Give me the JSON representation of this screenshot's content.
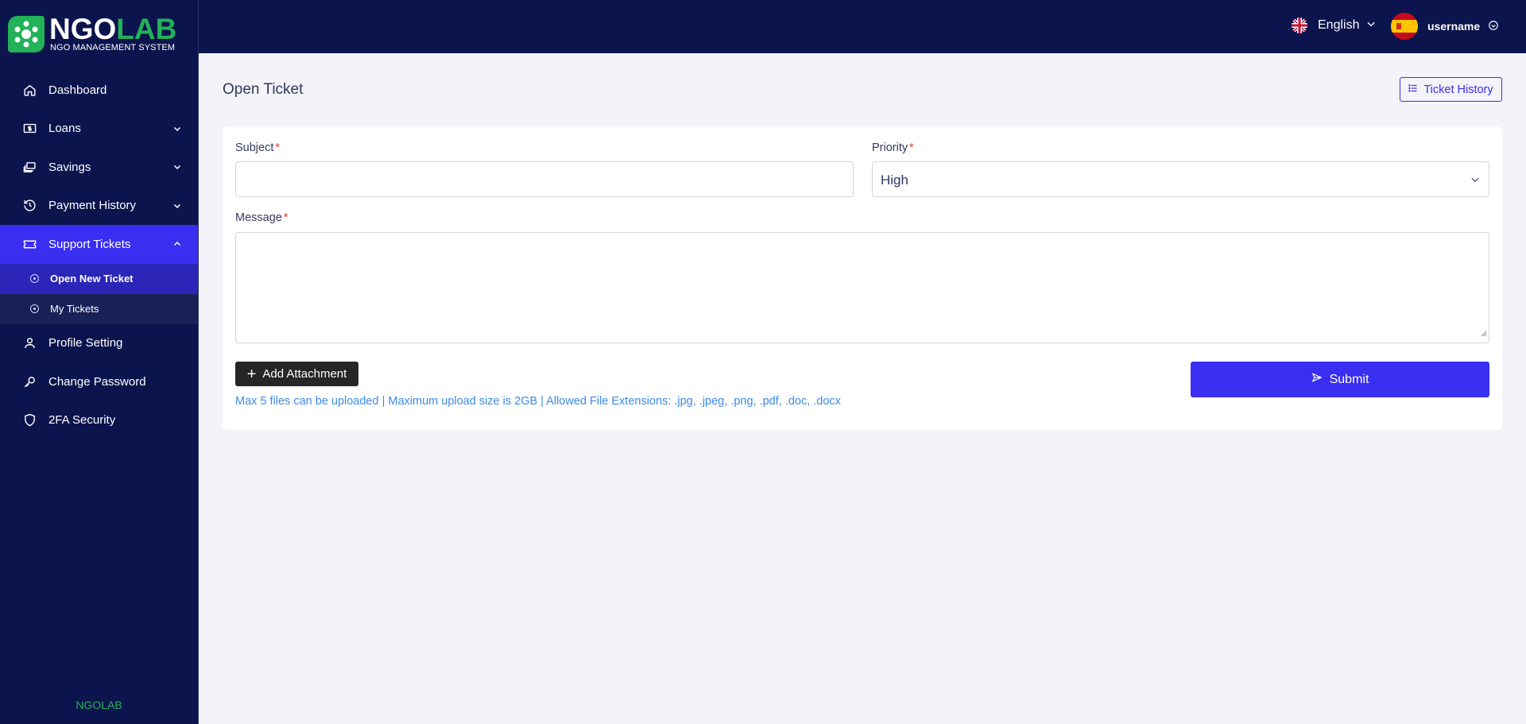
{
  "brand": {
    "logo_part1": "NGO",
    "logo_part2": "LAB",
    "tagline": "NGO MANAGEMENT SYSTEM",
    "footer": "NGOLAB",
    "colors": {
      "primary": "#3a2ef0",
      "sidebar": "#0c144d",
      "brand_green": "#22b257"
    }
  },
  "sidebar": {
    "items": [
      {
        "label": "Dashboard",
        "icon": "home-icon"
      },
      {
        "label": "Loans",
        "icon": "dollar-bill-icon"
      },
      {
        "label": "Savings",
        "icon": "money-stack-icon"
      },
      {
        "label": "Payment History",
        "icon": "history-icon"
      },
      {
        "label": "Support Tickets",
        "icon": "ticket-icon",
        "expanded": true,
        "children": [
          {
            "label": "Open New Ticket"
          },
          {
            "label": "My Tickets"
          }
        ]
      },
      {
        "label": "Profile Setting",
        "icon": "user-icon"
      },
      {
        "label": "Change Password",
        "icon": "key-icon"
      },
      {
        "label": "2FA Security",
        "icon": "shield-icon"
      }
    ]
  },
  "header": {
    "language": "English",
    "username": "username"
  },
  "main": {
    "title": "Open Ticket",
    "history_button": "Ticket History",
    "form": {
      "subject_label": "Subject",
      "subject_value": "",
      "priority_label": "Priority",
      "priority_value": "High",
      "message_label": "Message",
      "message_value": "",
      "required_mark": "*",
      "attach_label": "Add Attachment",
      "hint": "Max 5 files can be uploaded | Maximum upload size is 2GB | Allowed File Extensions: .jpg, .jpeg, .png, .pdf, .doc, .docx",
      "submit_label": "Submit"
    }
  }
}
